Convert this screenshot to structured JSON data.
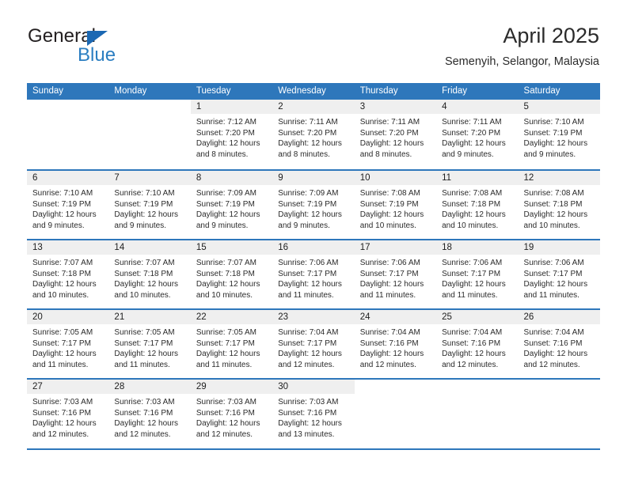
{
  "brand": {
    "word_one": "General",
    "word_two": "Blue",
    "triangle_icon": "triangle-icon",
    "accent_color": "#2b7ec1",
    "header_color": "#2e77bb"
  },
  "header": {
    "title": "April 2025",
    "subtitle": "Semenyih, Selangor, Malaysia"
  },
  "calendar": {
    "weekdays": [
      "Sunday",
      "Monday",
      "Tuesday",
      "Wednesday",
      "Thursday",
      "Friday",
      "Saturday"
    ],
    "weeks": [
      [
        {
          "day": "",
          "sunrise": "",
          "sunset": "",
          "daylight_1": "",
          "daylight_2": "",
          "empty": true
        },
        {
          "day": "",
          "sunrise": "",
          "sunset": "",
          "daylight_1": "",
          "daylight_2": "",
          "empty": true
        },
        {
          "day": "1",
          "sunrise": "Sunrise: 7:12 AM",
          "sunset": "Sunset: 7:20 PM",
          "daylight_1": "Daylight: 12 hours",
          "daylight_2": "and 8 minutes."
        },
        {
          "day": "2",
          "sunrise": "Sunrise: 7:11 AM",
          "sunset": "Sunset: 7:20 PM",
          "daylight_1": "Daylight: 12 hours",
          "daylight_2": "and 8 minutes."
        },
        {
          "day": "3",
          "sunrise": "Sunrise: 7:11 AM",
          "sunset": "Sunset: 7:20 PM",
          "daylight_1": "Daylight: 12 hours",
          "daylight_2": "and 8 minutes."
        },
        {
          "day": "4",
          "sunrise": "Sunrise: 7:11 AM",
          "sunset": "Sunset: 7:20 PM",
          "daylight_1": "Daylight: 12 hours",
          "daylight_2": "and 9 minutes."
        },
        {
          "day": "5",
          "sunrise": "Sunrise: 7:10 AM",
          "sunset": "Sunset: 7:19 PM",
          "daylight_1": "Daylight: 12 hours",
          "daylight_2": "and 9 minutes."
        }
      ],
      [
        {
          "day": "6",
          "sunrise": "Sunrise: 7:10 AM",
          "sunset": "Sunset: 7:19 PM",
          "daylight_1": "Daylight: 12 hours",
          "daylight_2": "and 9 minutes."
        },
        {
          "day": "7",
          "sunrise": "Sunrise: 7:10 AM",
          "sunset": "Sunset: 7:19 PM",
          "daylight_1": "Daylight: 12 hours",
          "daylight_2": "and 9 minutes."
        },
        {
          "day": "8",
          "sunrise": "Sunrise: 7:09 AM",
          "sunset": "Sunset: 7:19 PM",
          "daylight_1": "Daylight: 12 hours",
          "daylight_2": "and 9 minutes."
        },
        {
          "day": "9",
          "sunrise": "Sunrise: 7:09 AM",
          "sunset": "Sunset: 7:19 PM",
          "daylight_1": "Daylight: 12 hours",
          "daylight_2": "and 9 minutes."
        },
        {
          "day": "10",
          "sunrise": "Sunrise: 7:08 AM",
          "sunset": "Sunset: 7:19 PM",
          "daylight_1": "Daylight: 12 hours",
          "daylight_2": "and 10 minutes."
        },
        {
          "day": "11",
          "sunrise": "Sunrise: 7:08 AM",
          "sunset": "Sunset: 7:18 PM",
          "daylight_1": "Daylight: 12 hours",
          "daylight_2": "and 10 minutes."
        },
        {
          "day": "12",
          "sunrise": "Sunrise: 7:08 AM",
          "sunset": "Sunset: 7:18 PM",
          "daylight_1": "Daylight: 12 hours",
          "daylight_2": "and 10 minutes."
        }
      ],
      [
        {
          "day": "13",
          "sunrise": "Sunrise: 7:07 AM",
          "sunset": "Sunset: 7:18 PM",
          "daylight_1": "Daylight: 12 hours",
          "daylight_2": "and 10 minutes."
        },
        {
          "day": "14",
          "sunrise": "Sunrise: 7:07 AM",
          "sunset": "Sunset: 7:18 PM",
          "daylight_1": "Daylight: 12 hours",
          "daylight_2": "and 10 minutes."
        },
        {
          "day": "15",
          "sunrise": "Sunrise: 7:07 AM",
          "sunset": "Sunset: 7:18 PM",
          "daylight_1": "Daylight: 12 hours",
          "daylight_2": "and 10 minutes."
        },
        {
          "day": "16",
          "sunrise": "Sunrise: 7:06 AM",
          "sunset": "Sunset: 7:17 PM",
          "daylight_1": "Daylight: 12 hours",
          "daylight_2": "and 11 minutes."
        },
        {
          "day": "17",
          "sunrise": "Sunrise: 7:06 AM",
          "sunset": "Sunset: 7:17 PM",
          "daylight_1": "Daylight: 12 hours",
          "daylight_2": "and 11 minutes."
        },
        {
          "day": "18",
          "sunrise": "Sunrise: 7:06 AM",
          "sunset": "Sunset: 7:17 PM",
          "daylight_1": "Daylight: 12 hours",
          "daylight_2": "and 11 minutes."
        },
        {
          "day": "19",
          "sunrise": "Sunrise: 7:06 AM",
          "sunset": "Sunset: 7:17 PM",
          "daylight_1": "Daylight: 12 hours",
          "daylight_2": "and 11 minutes."
        }
      ],
      [
        {
          "day": "20",
          "sunrise": "Sunrise: 7:05 AM",
          "sunset": "Sunset: 7:17 PM",
          "daylight_1": "Daylight: 12 hours",
          "daylight_2": "and 11 minutes."
        },
        {
          "day": "21",
          "sunrise": "Sunrise: 7:05 AM",
          "sunset": "Sunset: 7:17 PM",
          "daylight_1": "Daylight: 12 hours",
          "daylight_2": "and 11 minutes."
        },
        {
          "day": "22",
          "sunrise": "Sunrise: 7:05 AM",
          "sunset": "Sunset: 7:17 PM",
          "daylight_1": "Daylight: 12 hours",
          "daylight_2": "and 11 minutes."
        },
        {
          "day": "23",
          "sunrise": "Sunrise: 7:04 AM",
          "sunset": "Sunset: 7:17 PM",
          "daylight_1": "Daylight: 12 hours",
          "daylight_2": "and 12 minutes."
        },
        {
          "day": "24",
          "sunrise": "Sunrise: 7:04 AM",
          "sunset": "Sunset: 7:16 PM",
          "daylight_1": "Daylight: 12 hours",
          "daylight_2": "and 12 minutes."
        },
        {
          "day": "25",
          "sunrise": "Sunrise: 7:04 AM",
          "sunset": "Sunset: 7:16 PM",
          "daylight_1": "Daylight: 12 hours",
          "daylight_2": "and 12 minutes."
        },
        {
          "day": "26",
          "sunrise": "Sunrise: 7:04 AM",
          "sunset": "Sunset: 7:16 PM",
          "daylight_1": "Daylight: 12 hours",
          "daylight_2": "and 12 minutes."
        }
      ],
      [
        {
          "day": "27",
          "sunrise": "Sunrise: 7:03 AM",
          "sunset": "Sunset: 7:16 PM",
          "daylight_1": "Daylight: 12 hours",
          "daylight_2": "and 12 minutes."
        },
        {
          "day": "28",
          "sunrise": "Sunrise: 7:03 AM",
          "sunset": "Sunset: 7:16 PM",
          "daylight_1": "Daylight: 12 hours",
          "daylight_2": "and 12 minutes."
        },
        {
          "day": "29",
          "sunrise": "Sunrise: 7:03 AM",
          "sunset": "Sunset: 7:16 PM",
          "daylight_1": "Daylight: 12 hours",
          "daylight_2": "and 12 minutes."
        },
        {
          "day": "30",
          "sunrise": "Sunrise: 7:03 AM",
          "sunset": "Sunset: 7:16 PM",
          "daylight_1": "Daylight: 12 hours",
          "daylight_2": "and 13 minutes."
        },
        {
          "day": "",
          "sunrise": "",
          "sunset": "",
          "daylight_1": "",
          "daylight_2": "",
          "empty": true
        },
        {
          "day": "",
          "sunrise": "",
          "sunset": "",
          "daylight_1": "",
          "daylight_2": "",
          "empty": true
        },
        {
          "day": "",
          "sunrise": "",
          "sunset": "",
          "daylight_1": "",
          "daylight_2": "",
          "empty": true
        }
      ]
    ]
  }
}
